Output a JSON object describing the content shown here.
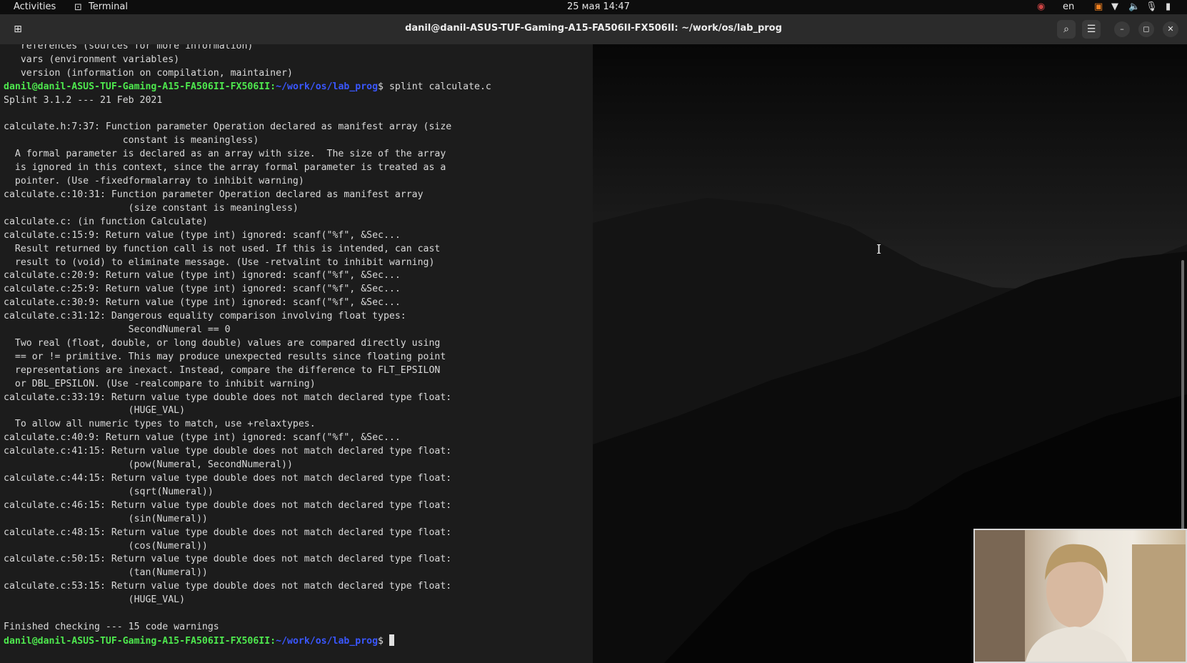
{
  "topbar": {
    "activities": "Activities",
    "app_name": "Terminal",
    "datetime": "25 мая  14:47",
    "language": "en"
  },
  "window": {
    "title": "danil@danil-ASUS-TUF-Gaming-A15-FA506II-FX506II: ~/work/os/lab_prog"
  },
  "terminal": {
    "prompt_user": "danil@danil-ASUS-TUF-Gaming-A15-FA506II-FX506II",
    "prompt_path": "~/work/os/lab_prog",
    "head_lines": [
      "   references (sources for more information)",
      "   vars (environment variables)",
      "   version (information on compilation, maintainer)"
    ],
    "command": "splint calculate.c",
    "output_lines": [
      "Splint 3.1.2 --- 21 Feb 2021",
      "",
      "calculate.h:7:37: Function parameter Operation declared as manifest array (size",
      "                     constant is meaningless)",
      "  A formal parameter is declared as an array with size.  The size of the array",
      "  is ignored in this context, since the array formal parameter is treated as a",
      "  pointer. (Use -fixedformalarray to inhibit warning)",
      "calculate.c:10:31: Function parameter Operation declared as manifest array",
      "                      (size constant is meaningless)",
      "calculate.c: (in function Calculate)",
      "calculate.c:15:9: Return value (type int) ignored: scanf(\"%f\", &Sec...",
      "  Result returned by function call is not used. If this is intended, can cast",
      "  result to (void) to eliminate message. (Use -retvalint to inhibit warning)",
      "calculate.c:20:9: Return value (type int) ignored: scanf(\"%f\", &Sec...",
      "calculate.c:25:9: Return value (type int) ignored: scanf(\"%f\", &Sec...",
      "calculate.c:30:9: Return value (type int) ignored: scanf(\"%f\", &Sec...",
      "calculate.c:31:12: Dangerous equality comparison involving float types:",
      "                      SecondNumeral == 0",
      "  Two real (float, double, or long double) values are compared directly using",
      "  == or != primitive. This may produce unexpected results since floating point",
      "  representations are inexact. Instead, compare the difference to FLT_EPSILON",
      "  or DBL_EPSILON. (Use -realcompare to inhibit warning)",
      "calculate.c:33:19: Return value type double does not match declared type float:",
      "                      (HUGE_VAL)",
      "  To allow all numeric types to match, use +relaxtypes.",
      "calculate.c:40:9: Return value (type int) ignored: scanf(\"%f\", &Sec...",
      "calculate.c:41:15: Return value type double does not match declared type float:",
      "                      (pow(Numeral, SecondNumeral))",
      "calculate.c:44:15: Return value type double does not match declared type float:",
      "                      (sqrt(Numeral))",
      "calculate.c:46:15: Return value type double does not match declared type float:",
      "                      (sin(Numeral))",
      "calculate.c:48:15: Return value type double does not match declared type float:",
      "                      (cos(Numeral))",
      "calculate.c:50:15: Return value type double does not match declared type float:",
      "                      (tan(Numeral))",
      "calculate.c:53:15: Return value type double does not match declared type float:",
      "                      (HUGE_VAL)",
      "",
      "Finished checking --- 15 code warnings"
    ]
  },
  "icons": [
    "new-tab-icon",
    "terminal-icon",
    "search-icon",
    "menu-icon",
    "minimize-icon",
    "maximize-icon",
    "close-icon",
    "wifi-icon",
    "volume-icon",
    "microphone-icon",
    "battery-icon"
  ]
}
